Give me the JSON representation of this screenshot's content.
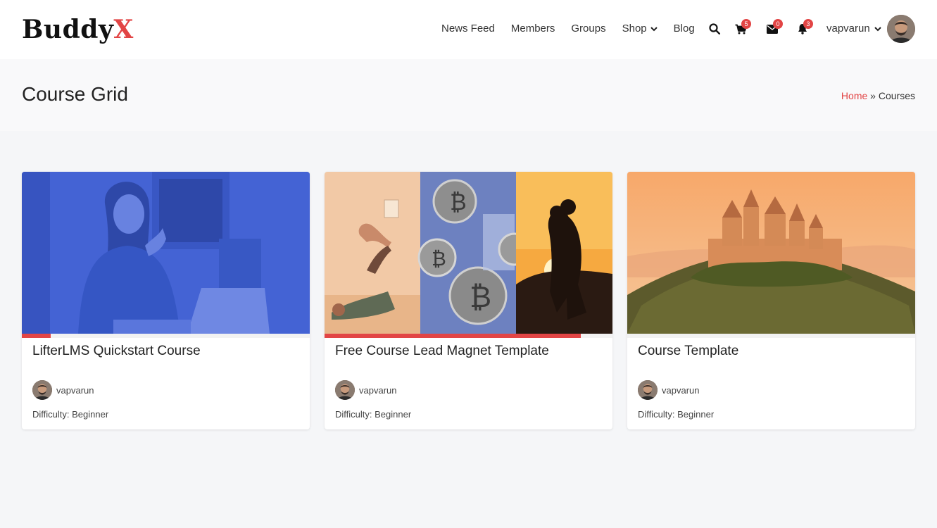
{
  "brand": {
    "logo_main": "Buddy",
    "logo_accent": "X",
    "accent_color": "#e24545"
  },
  "nav": {
    "items": [
      {
        "label": "News Feed"
      },
      {
        "label": "Members"
      },
      {
        "label": "Groups"
      },
      {
        "label": "Shop"
      },
      {
        "label": "Blog"
      }
    ]
  },
  "header_icons": {
    "search": {
      "icon": "search-icon"
    },
    "cart": {
      "icon": "cart-icon",
      "count": "5"
    },
    "messages": {
      "icon": "envelope-icon",
      "count": "0"
    },
    "notifications": {
      "icon": "bell-icon",
      "count": "3"
    }
  },
  "user": {
    "name": "vapvarun"
  },
  "page": {
    "title": "Course Grid",
    "breadcrumb": {
      "home": "Home",
      "separator": "»",
      "current": "Courses"
    }
  },
  "courses": [
    {
      "title": "LifterLMS Quickstart Course",
      "author": "vapvarun",
      "difficulty": "Difficulty: Beginner",
      "progress": 0.1
    },
    {
      "title": "Free Course Lead Magnet Template",
      "author": "vapvarun",
      "difficulty": "Difficulty: Beginner",
      "progress": 0.89
    },
    {
      "title": "Course Template",
      "author": "vapvarun",
      "difficulty": "Difficulty: Beginner",
      "progress": 0
    }
  ]
}
